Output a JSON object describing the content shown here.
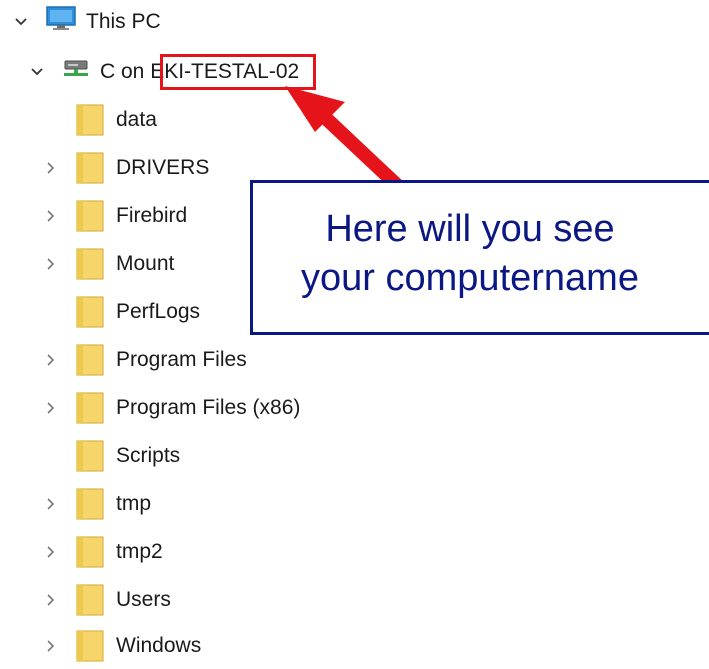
{
  "tree": {
    "this_pc": "This PC",
    "drive": {
      "prefix": "C on ",
      "computer_name": "EKI-TESTAL-02"
    },
    "folders": [
      {
        "label": "data",
        "expandable": false
      },
      {
        "label": "DRIVERS",
        "expandable": true
      },
      {
        "label": "Firebird",
        "expandable": true
      },
      {
        "label": "Mount",
        "expandable": true
      },
      {
        "label": "PerfLogs",
        "expandable": false
      },
      {
        "label": "Program Files",
        "expandable": true
      },
      {
        "label": "Program Files (x86)",
        "expandable": true
      },
      {
        "label": "Scripts",
        "expandable": false
      },
      {
        "label": "tmp",
        "expandable": true
      },
      {
        "label": "tmp2",
        "expandable": true
      },
      {
        "label": "Users",
        "expandable": true
      },
      {
        "label": "Windows",
        "expandable": true
      }
    ]
  },
  "annotation": {
    "line1": "Here will you see",
    "line2": "your computername",
    "highlight_color": "#e5141b",
    "callout_color": "#0b1782"
  },
  "icons": {
    "folder_color": "#f6d66b",
    "pc_color": "#2f8fdd",
    "drive_color": "#3aa64a"
  }
}
